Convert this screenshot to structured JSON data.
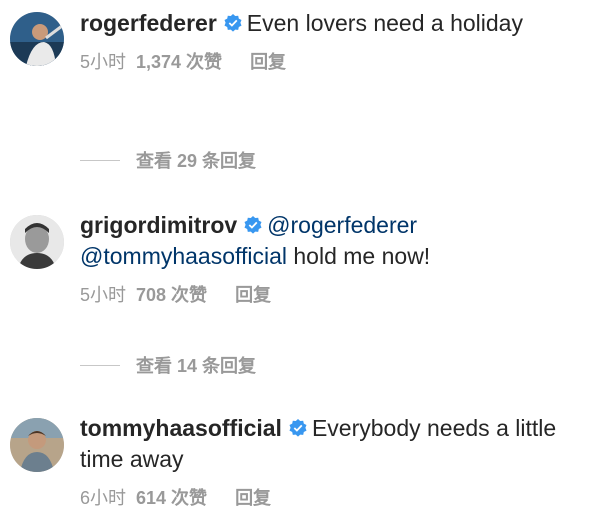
{
  "comments": [
    {
      "username": "rogerfederer",
      "text": "Even lovers need a holiday",
      "mentions": [],
      "time": "5小时",
      "likes": "1,374 次赞",
      "reply": "回复",
      "view_replies": "查看 29 条回复"
    },
    {
      "username": "grigordimitrov",
      "text": "hold me now!",
      "mentions": [
        "@rogerfederer",
        "@tommyhaasofficial"
      ],
      "time": "5小时",
      "likes": "708 次赞",
      "reply": "回复",
      "view_replies": "查看 14 条回复"
    },
    {
      "username": "tommyhaasofficial",
      "text": "Everybody needs a little time away",
      "mentions": [],
      "time": "6小时",
      "likes": "614 次赞",
      "reply": "回复"
    }
  ],
  "colors": {
    "verified_blue": "#3897f0",
    "mention": "#003569",
    "meta": "#999999",
    "text": "#262626"
  },
  "icons": {
    "verified": "verified-badge-icon"
  }
}
